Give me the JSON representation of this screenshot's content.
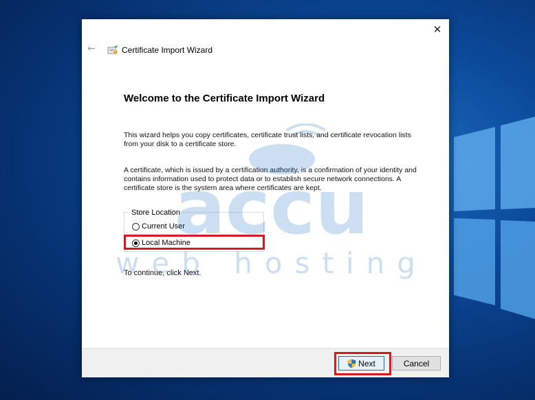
{
  "dialog": {
    "title": "Certificate Import Wizard",
    "heading": "Welcome to the Certificate Import Wizard",
    "paragraph1": "This wizard helps you copy certificates, certificate trust lists, and certificate revocation lists from your disk to a certificate store.",
    "paragraph2": "A certificate, which is issued by a certification authority, is a confirmation of your identity and contains information used to protect data or to establish secure network connections. A certificate store is the system area where certificates are kept.",
    "store_location_label": "Store Location",
    "options": [
      {
        "label": "Current User",
        "selected": false
      },
      {
        "label": "Local Machine",
        "selected": true
      }
    ],
    "continue_text": "To continue, click Next.",
    "next_label": "Next",
    "cancel_label": "Cancel",
    "close_glyph": "✕",
    "back_glyph": "←"
  },
  "watermark": {
    "line1": "accu",
    "line2": "web hosting"
  },
  "colors": {
    "highlight": "#d71920",
    "desktop": "#0b4a9a",
    "accent": "#0078d7"
  }
}
